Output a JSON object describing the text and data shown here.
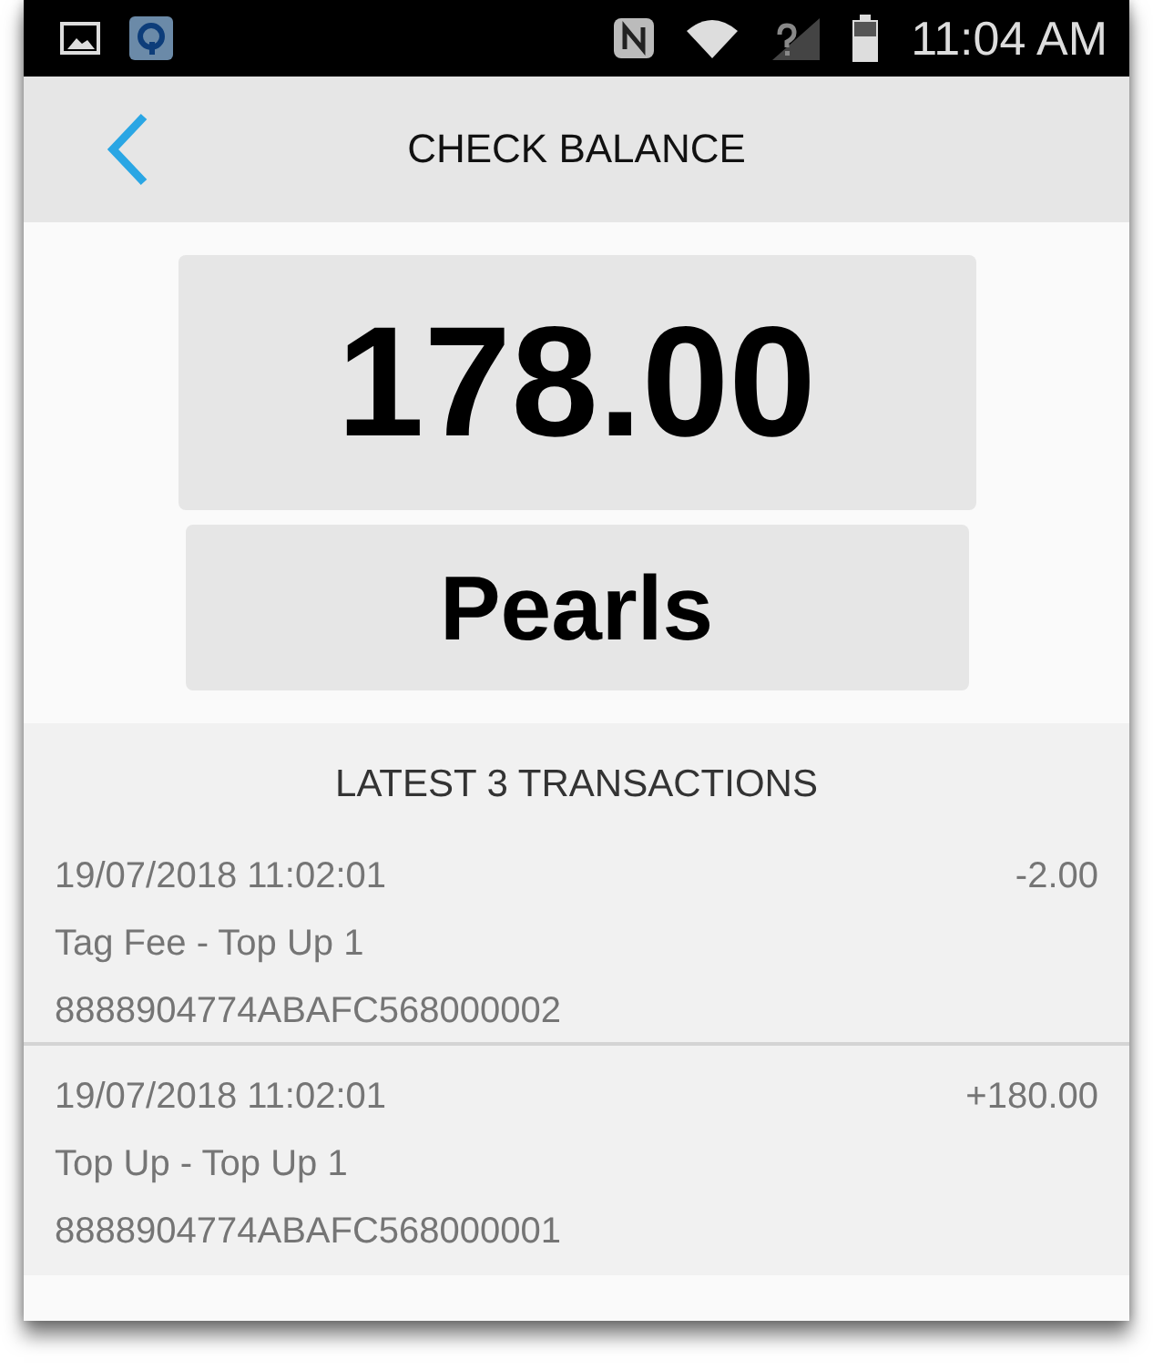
{
  "status_bar": {
    "time": "11:04 AM"
  },
  "header": {
    "title": "CHECK BALANCE"
  },
  "balance": {
    "amount": "178.00",
    "unit": "Pearls"
  },
  "transactions": {
    "title": "LATEST 3 TRANSACTIONS",
    "items": [
      {
        "datetime": "19/07/2018 11:02:01",
        "amount": "-2.00",
        "description": "Tag Fee - Top Up 1",
        "reference": "8888904774ABAFC568000002"
      },
      {
        "datetime": "19/07/2018 11:02:01",
        "amount": "+180.00",
        "description": "Top Up - Top Up 1",
        "reference": "8888904774ABAFC568000001"
      }
    ]
  }
}
